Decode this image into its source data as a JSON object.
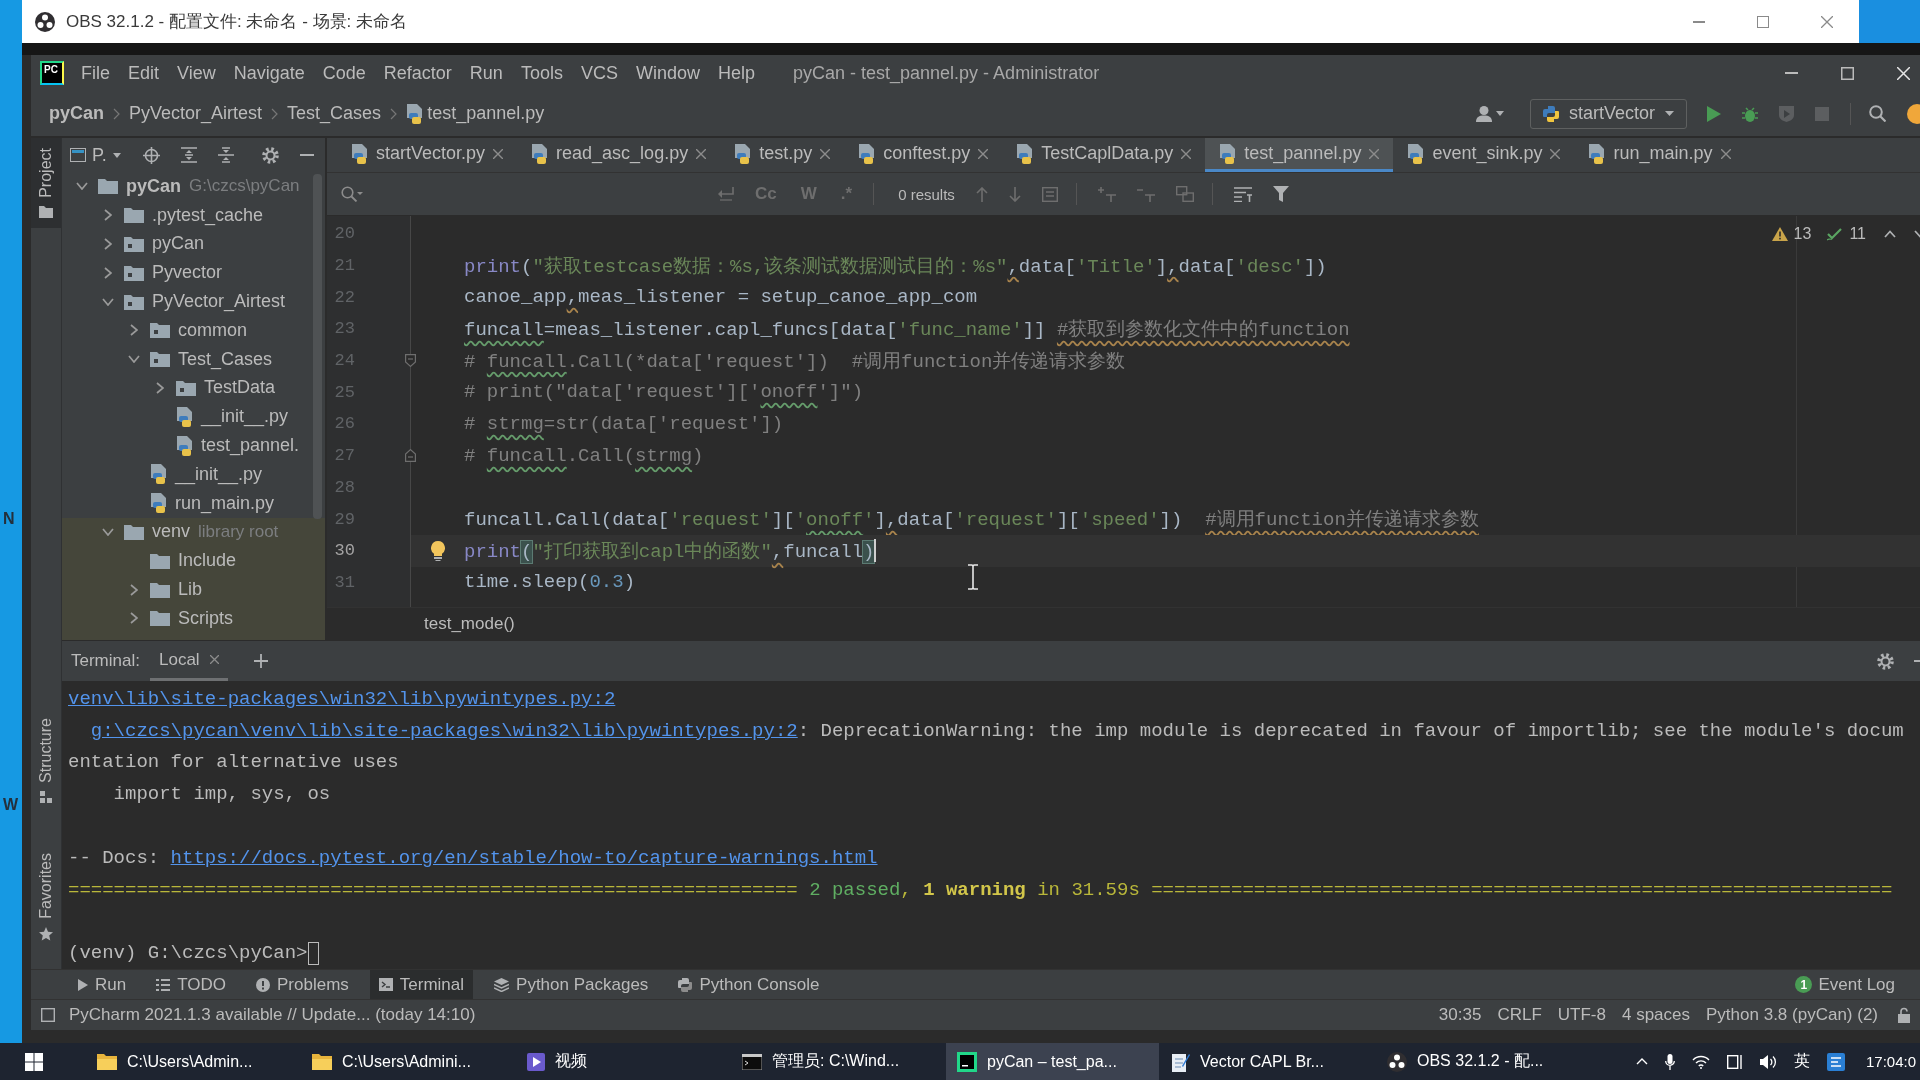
{
  "desktop": {
    "edge_labels": [
      "N",
      "W"
    ]
  },
  "obs_window": {
    "title": "OBS 32.1.2 - 配置文件: 未命名 - 场景: 未命名"
  },
  "pycharm": {
    "logo": "PC",
    "menu": [
      "File",
      "Edit",
      "View",
      "Navigate",
      "Code",
      "Refactor",
      "Run",
      "Tools",
      "VCS",
      "Window",
      "Help"
    ],
    "window_title": "pyCan - test_pannel.py - Administrator",
    "breadcrumb": [
      "pyCan",
      "PyVector_Airtest",
      "Test_Cases",
      "test_pannel.py"
    ],
    "run_config": "startVector",
    "tool_strip": {
      "top": [
        {
          "label": "Project",
          "selected": true
        }
      ],
      "bottom": [
        {
          "label": "Structure",
          "selected": false
        },
        {
          "label": "Favorites",
          "selected": false
        }
      ]
    },
    "project": {
      "title": "P.",
      "tree": [
        {
          "label": "pyCan",
          "hint": "G:\\czcs\\pyCan",
          "kind": "root",
          "expanded": true,
          "children": [
            {
              "label": ".pytest_cache",
              "kind": "folder",
              "expanded": false
            },
            {
              "label": "pyCan",
              "kind": "package",
              "expanded": false
            },
            {
              "label": "Pyvector",
              "kind": "package",
              "expanded": false
            },
            {
              "label": "PyVector_Airtest",
              "kind": "package",
              "expanded": true,
              "children": [
                {
                  "label": "common",
                  "kind": "package",
                  "expanded": false
                },
                {
                  "label": "Test_Cases",
                  "kind": "package",
                  "expanded": true,
                  "children": [
                    {
                      "label": "TestData",
                      "kind": "package",
                      "expanded": false
                    },
                    {
                      "label": "__init__.py",
                      "kind": "python"
                    },
                    {
                      "label": "test_pannel.",
                      "kind": "python"
                    }
                  ]
                },
                {
                  "label": "__init__.py",
                  "kind": "python"
                },
                {
                  "label": "run_main.py",
                  "kind": "python"
                }
              ]
            },
            {
              "label": "venv",
              "hint": "library root",
              "kind": "folder",
              "library": true,
              "expanded": true,
              "children": [
                {
                  "label": "Include",
                  "kind": "folder"
                },
                {
                  "label": "Lib",
                  "kind": "folder",
                  "expanded": false
                },
                {
                  "label": "Scripts",
                  "kind": "folder",
                  "expanded": false
                }
              ]
            }
          ]
        }
      ]
    },
    "tabs": [
      {
        "label": "startVector.py",
        "selected": false
      },
      {
        "label": "read_asc_log.py",
        "selected": false
      },
      {
        "label": "test.py",
        "selected": false
      },
      {
        "label": "conftest.py",
        "selected": false
      },
      {
        "label": "TestCaplData.py",
        "selected": false
      },
      {
        "label": "test_pannel.py",
        "selected": true
      },
      {
        "label": "event_sink.py",
        "selected": false
      },
      {
        "label": "run_main.py",
        "selected": false
      }
    ],
    "find": {
      "toggles": [
        {
          "label": "Cc",
          "selected": false
        },
        {
          "label": "W",
          "selected": false
        },
        {
          "label": ".*",
          "selected": false
        }
      ],
      "results": "0 results"
    },
    "inspections": {
      "warnings": "13",
      "typos": "11"
    },
    "editor": {
      "lines": [
        {
          "number": "20",
          "current": false,
          "bulb": false
        },
        {
          "number": "21",
          "current": false,
          "bulb": false,
          "tokens": [
            {
              "text": "print",
              "kind": "builtin"
            },
            {
              "text": "(",
              "kind": "plain"
            },
            {
              "text": "\"获取testcase数据：%s,该条测试数据测试目的：%s\"",
              "kind": "string"
            },
            {
              "text": ",",
              "kind": "plain",
              "weak_warning": true
            },
            {
              "text": "data[",
              "kind": "plain"
            },
            {
              "text": "'Title'",
              "kind": "string"
            },
            {
              "text": "]",
              "kind": "plain"
            },
            {
              "text": ",",
              "kind": "plain",
              "weak_warning": true
            },
            {
              "text": "data[",
              "kind": "plain"
            },
            {
              "text": "'desc'",
              "kind": "string"
            },
            {
              "text": "])",
              "kind": "plain"
            }
          ]
        },
        {
          "number": "22",
          "current": false,
          "bulb": false,
          "tokens": [
            {
              "text": "canoe_app",
              "kind": "plain"
            },
            {
              "text": ",",
              "kind": "plain",
              "weak_warning": true
            },
            {
              "text": "meas_listener = setup_canoe_app_com",
              "kind": "plain"
            }
          ]
        },
        {
          "number": "23",
          "current": false,
          "bulb": false,
          "tokens": [
            {
              "text": "funcall",
              "kind": "plain",
              "typo": true
            },
            {
              "text": "=meas_listener.capl_funcs[data[",
              "kind": "plain"
            },
            {
              "text": "'func_name'",
              "kind": "string"
            },
            {
              "text": "]] ",
              "kind": "plain"
            },
            {
              "text": "#获取到参数化文件中的function",
              "kind": "comment",
              "weak_warning": true
            }
          ]
        },
        {
          "number": "24",
          "current": false,
          "bulb": false,
          "fold_start": true,
          "tokens": [
            {
              "text": "# ",
              "kind": "comment"
            },
            {
              "text": "funcall",
              "kind": "comment",
              "typo": true
            },
            {
              "text": ".Call(*data['request'])  #调用function并传递请求参数",
              "kind": "comment"
            }
          ]
        },
        {
          "number": "25",
          "current": false,
          "bulb": false,
          "tokens": [
            {
              "text": "# print(\"data['request']['",
              "kind": "comment"
            },
            {
              "text": "onoff",
              "kind": "comment",
              "typo": true
            },
            {
              "text": "']\")",
              "kind": "comment"
            }
          ]
        },
        {
          "number": "26",
          "current": false,
          "bulb": false,
          "tokens": [
            {
              "text": "# ",
              "kind": "comment"
            },
            {
              "text": "strmg",
              "kind": "comment",
              "typo": true
            },
            {
              "text": "=str(data['request'])",
              "kind": "comment"
            }
          ]
        },
        {
          "number": "27",
          "current": false,
          "bulb": false,
          "fold_end": true,
          "tokens": [
            {
              "text": "# ",
              "kind": "comment"
            },
            {
              "text": "funcall",
              "kind": "comment",
              "typo": true
            },
            {
              "text": ".Call(",
              "kind": "comment"
            },
            {
              "text": "strmg",
              "kind": "comment",
              "typo": true
            },
            {
              "text": ")",
              "kind": "comment"
            }
          ]
        },
        {
          "number": "28",
          "current": false,
          "bulb": false
        },
        {
          "number": "29",
          "current": false,
          "bulb": false,
          "tokens": [
            {
              "text": "funcall.Call(data[",
              "kind": "plain"
            },
            {
              "text": "'request'",
              "kind": "string"
            },
            {
              "text": "][",
              "kind": "plain"
            },
            {
              "text": "'",
              "kind": "string"
            },
            {
              "text": "onoff",
              "kind": "string",
              "typo": true
            },
            {
              "text": "'",
              "kind": "string"
            },
            {
              "text": "]",
              "kind": "plain"
            },
            {
              "text": ",",
              "kind": "plain",
              "weak_warning": true
            },
            {
              "text": "data[",
              "kind": "plain"
            },
            {
              "text": "'request'",
              "kind": "string"
            },
            {
              "text": "][",
              "kind": "plain"
            },
            {
              "text": "'speed'",
              "kind": "string"
            },
            {
              "text": "])  ",
              "kind": "plain"
            },
            {
              "text": "#调用function并传递请求参数",
              "kind": "comment",
              "weak_warning": true
            }
          ]
        },
        {
          "number": "30",
          "current": true,
          "bulb": true,
          "tokens": [
            {
              "text": "print",
              "kind": "builtin"
            },
            {
              "text": "(",
              "kind": "plain",
              "brace_match": true
            },
            {
              "text": "\"打印获取到capl中的函数\"",
              "kind": "string"
            },
            {
              "text": ",",
              "kind": "plain",
              "weak_warning": true
            },
            {
              "text": "funcall",
              "kind": "plain"
            },
            {
              "text": ")",
              "kind": "plain",
              "brace_match": true
            }
          ]
        },
        {
          "number": "31",
          "current": false,
          "bulb": false,
          "tokens": [
            {
              "text": "time.sleep(",
              "kind": "plain"
            },
            {
              "text": "0.3",
              "kind": "number"
            },
            {
              "text": ")",
              "kind": "plain"
            }
          ]
        }
      ],
      "breadcrumb": "test_mode()"
    },
    "terminal": {
      "title": "Terminal:",
      "tabs": [
        {
          "label": "Local",
          "selected": true
        }
      ],
      "lines": [
        {
          "kind": "path",
          "segments": [
            {
              "text": "venv\\lib\\site-packages\\win32\\lib\\pywintypes.py:2",
              "kind": "link"
            }
          ]
        },
        {
          "kind": "location",
          "segments": [
            {
              "text": "g:\\czcs\\pycan\\venv\\lib\\site-packages\\win32\\lib\\pywintypes.py:2",
              "kind": "link"
            },
            {
              "text": ": DeprecationWarning: the imp module is deprecated in favour of importlib; see the module's docum",
              "kind": "text"
            }
          ]
        },
        {
          "kind": "continuation",
          "segments": [
            {
              "text": "entation for alternative uses",
              "kind": "text"
            }
          ]
        },
        {
          "kind": "source",
          "segments": [
            {
              "text": "import imp, sys, os",
              "kind": "text"
            }
          ]
        },
        {
          "kind": "blank"
        },
        {
          "kind": "docs",
          "segments": [
            {
              "text": "-- Docs:",
              "kind": "text"
            },
            {
              "text": "https://docs.pytest.org/en/stable/how-to/capture-warnings.html",
              "kind": "link"
            }
          ]
        },
        {
          "kind": "summary",
          "segments": [
            {
              "text": "================================================================ ",
              "kind": "rule"
            },
            {
              "text": "2 passed",
              "kind": "passed"
            },
            {
              "text": ", ",
              "kind": "rule"
            },
            {
              "text": "1 warning",
              "kind": "warning"
            },
            {
              "text": " in 31.59s ",
              "kind": "rule"
            },
            {
              "text": "=================================================================",
              "kind": "rule"
            }
          ]
        },
        {
          "kind": "blank"
        },
        {
          "kind": "prompt",
          "cursor": true,
          "segments": [
            {
              "text": "(venv) G:\\czcs\\pyCan>",
              "kind": "text"
            }
          ]
        }
      ]
    },
    "tool_windows": [
      {
        "label": "Run",
        "selected": false
      },
      {
        "label": "TODO",
        "selected": false
      },
      {
        "label": "Problems",
        "selected": false
      },
      {
        "label": "Terminal",
        "selected": true
      },
      {
        "label": "Python Packages",
        "selected": false
      },
      {
        "label": "Python Console",
        "selected": false
      }
    ],
    "event_log": {
      "label": "Event Log",
      "badge": "1"
    },
    "status_bar": {
      "message": "PyCharm 2021.1.3 available // Update... (today 14:10)",
      "items": [
        "30:35",
        "CRLF",
        "UTF-8",
        "4 spaces",
        "Python 3.8 (pyCan) (2)"
      ]
    }
  },
  "taskbar": {
    "items": [
      {
        "label": "C:\\Users\\Admin...",
        "selected": false
      },
      {
        "label": "C:\\Users\\Admini...",
        "selected": false
      },
      {
        "label": "视频",
        "selected": false
      },
      {
        "label": "管理员: C:\\Wind...",
        "selected": false
      },
      {
        "label": "pyCan – test_pa...",
        "selected": true
      },
      {
        "label": "Vector CAPL Br...",
        "selected": false
      },
      {
        "label": "OBS 32.1.2 - 配...",
        "selected": false
      }
    ],
    "language": "英",
    "time": "17:04:0"
  }
}
